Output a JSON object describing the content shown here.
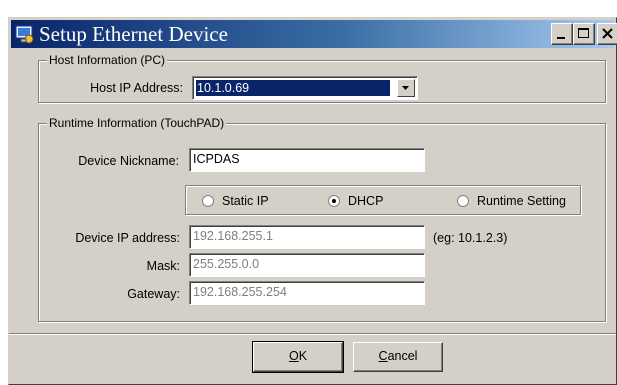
{
  "window": {
    "title": "Setup Ethernet Device",
    "icon": "ethernet-app-icon",
    "caption_buttons": [
      "minimize-icon",
      "maximize-icon",
      "close-icon"
    ]
  },
  "host_group": {
    "legend": "Host Information (PC)",
    "ip_label": "Host IP Address:",
    "ip_value": "10.1.0.69"
  },
  "runtime_group": {
    "legend": "Runtime Information (TouchPAD)",
    "nickname_label": "Device Nickname:",
    "nickname_value": "ICPDAS",
    "modes": [
      {
        "label": "Static IP",
        "selected": false
      },
      {
        "label": "DHCP",
        "selected": true
      },
      {
        "label": "Runtime Setting",
        "selected": false
      }
    ],
    "ip_label": "Device IP address:",
    "ip_value": "192.168.255.1",
    "ip_hint": "(eg: 10.1.2.3)",
    "mask_label": "Mask:",
    "mask_value": "255.255.0.0",
    "gateway_label": "Gateway:",
    "gateway_value": "192.168.255.254"
  },
  "buttons": {
    "ok_mnemonic": "O",
    "ok_rest": "K",
    "cancel_mnemonic": "C",
    "cancel_rest": "ancel"
  }
}
